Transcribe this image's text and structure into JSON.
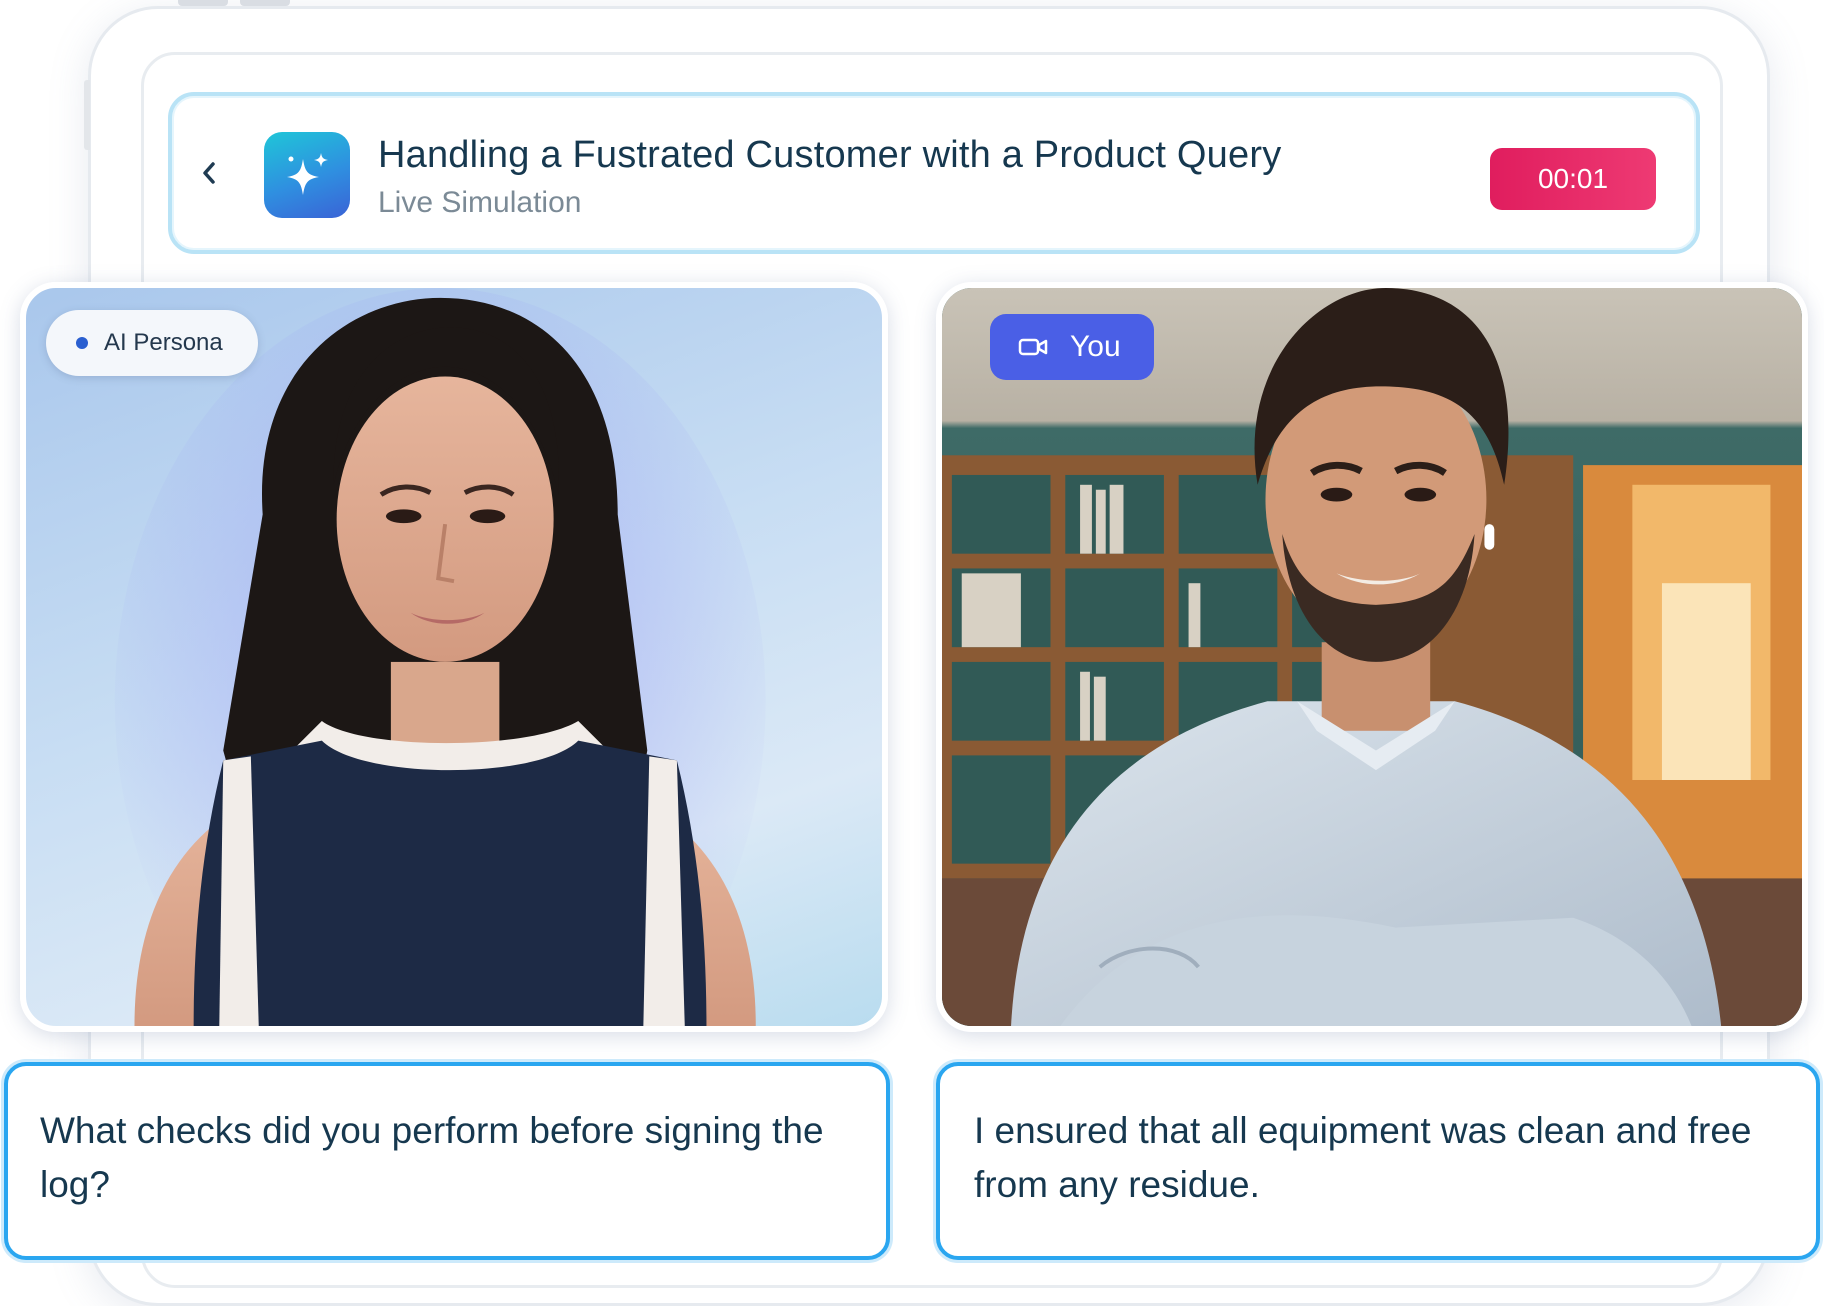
{
  "header": {
    "title": "Handling a Fustrated Customer with a Product Query",
    "subtitle": "Live Simulation",
    "timer": "00:01",
    "back_icon": "chevron-left-icon",
    "app_icon": "sparkle-icon"
  },
  "tiles": {
    "ai": {
      "badge": "AI Persona"
    },
    "you": {
      "badge": "You",
      "badge_icon": "video-camera-icon"
    }
  },
  "captions": {
    "ai": "What checks did you perform before signing the log?",
    "you": "I ensured that all equipment was clean and free from any residue."
  },
  "colors": {
    "accent": "#2aa6f0",
    "timer": "#e01d5e",
    "you_badge": "#4a5fe6",
    "text": "#16384f"
  }
}
